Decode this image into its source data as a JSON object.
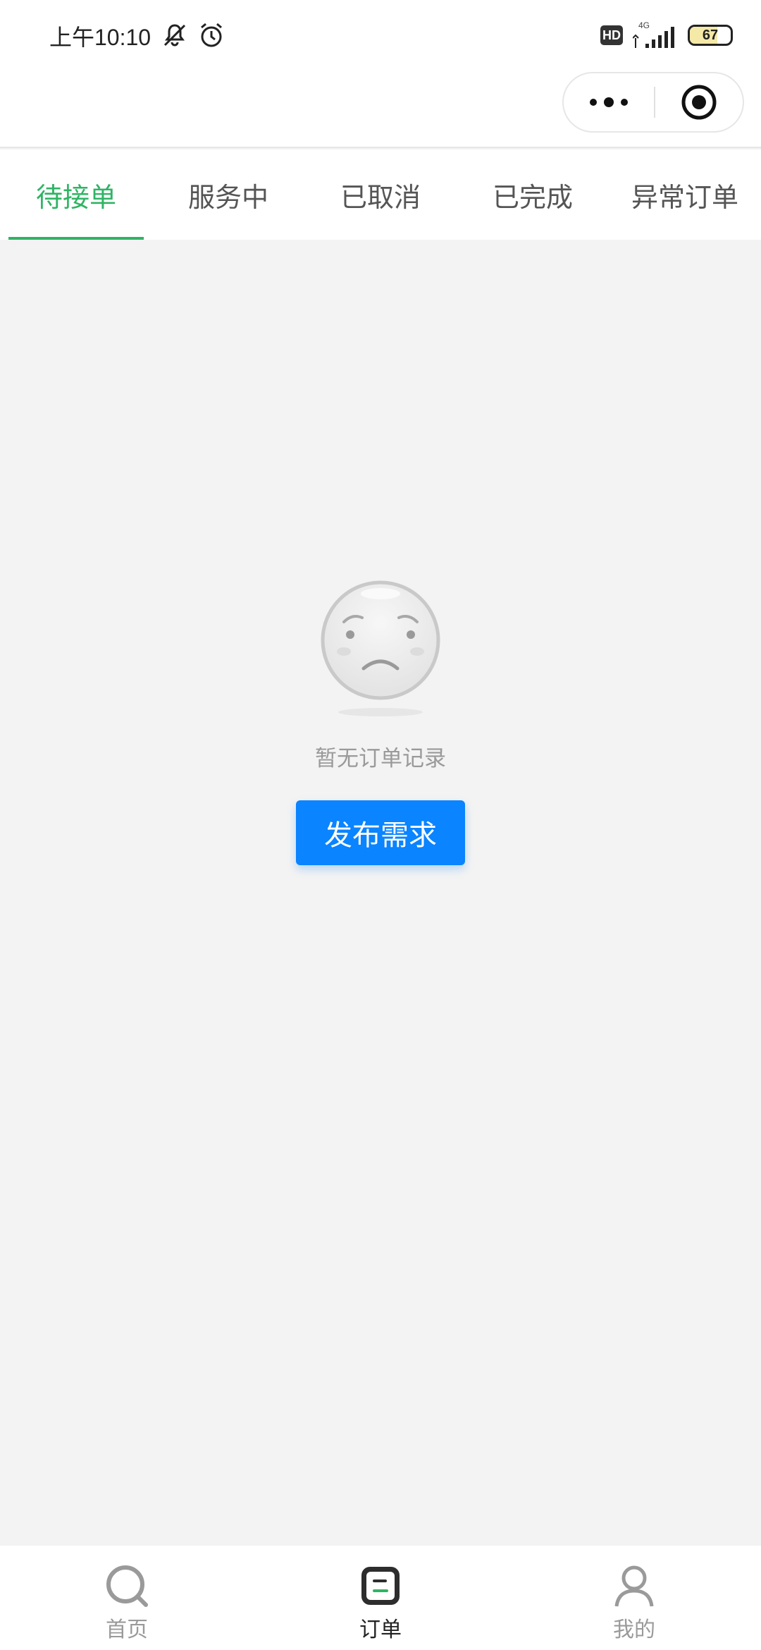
{
  "status_bar": {
    "time": "上午10:10",
    "network_label": "HD",
    "network_type": "4G",
    "battery": "67"
  },
  "tabs": [
    {
      "label": "待接单",
      "active": true
    },
    {
      "label": "服务中",
      "active": false
    },
    {
      "label": "已取消",
      "active": false
    },
    {
      "label": "已完成",
      "active": false
    },
    {
      "label": "异常订单",
      "active": false
    }
  ],
  "empty_state": {
    "message": "暂无订单记录",
    "button_label": "发布需求"
  },
  "bottom_nav": [
    {
      "label": "首页",
      "icon": "search-icon",
      "active": false
    },
    {
      "label": "订单",
      "icon": "order-icon",
      "active": true
    },
    {
      "label": "我的",
      "icon": "user-icon",
      "active": false
    }
  ],
  "colors": {
    "accent_green": "#2fb464",
    "primary_blue": "#0a84ff",
    "background": "#f3f3f3"
  }
}
